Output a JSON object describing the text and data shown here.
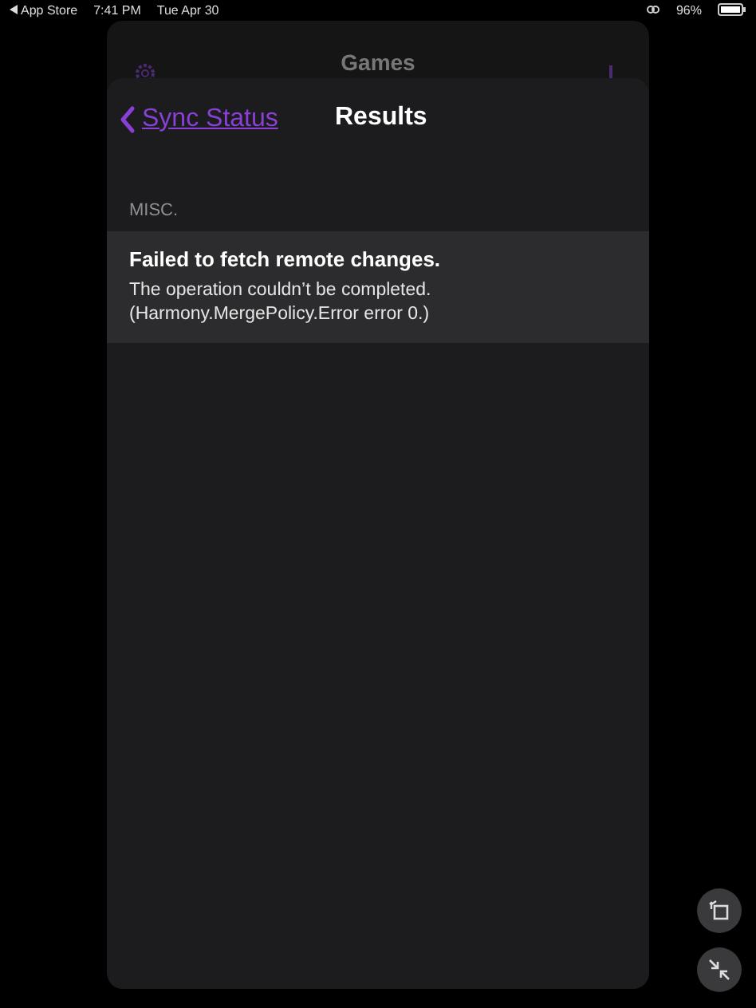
{
  "status_bar": {
    "back_app": "App Store",
    "time": "7:41 PM",
    "date": "Tue Apr 30",
    "battery": "96%"
  },
  "background_screen": {
    "title": "Games"
  },
  "sheet": {
    "back_label": "Sync Status",
    "title": "Results",
    "sections": [
      {
        "header": "MISC.",
        "rows": [
          {
            "title": "Failed to fetch remote changes.",
            "detail": "The operation couldn’t be completed.\n(Harmony.MergePolicy.Error error 0.)"
          }
        ]
      }
    ]
  }
}
